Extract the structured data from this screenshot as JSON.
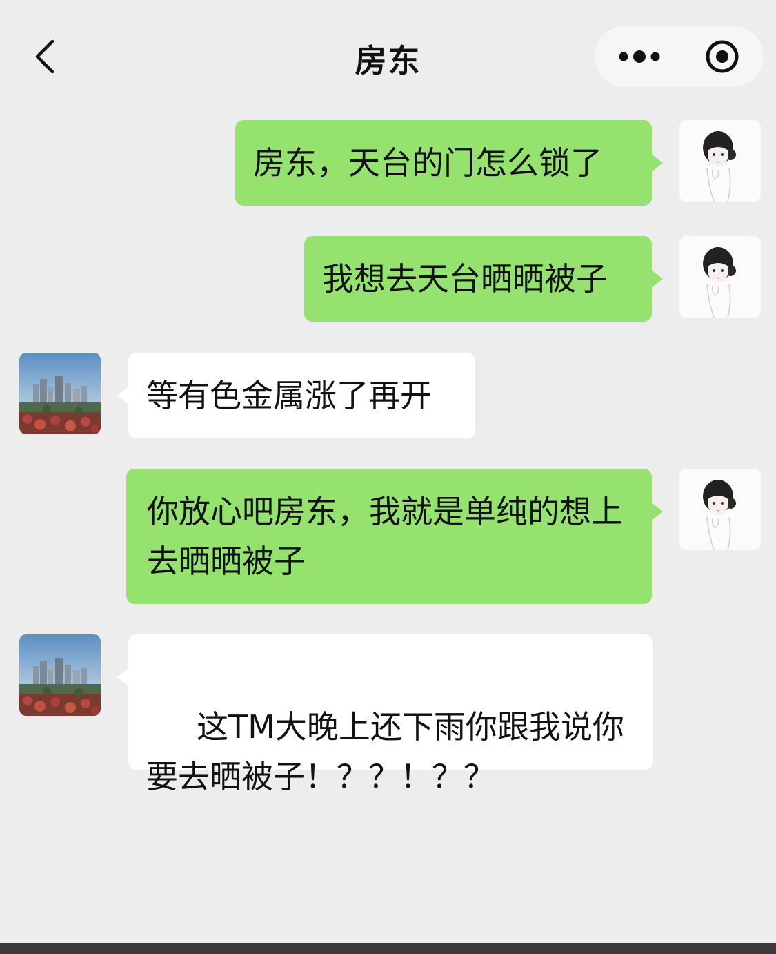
{
  "header": {
    "title": "房东",
    "back_icon": "chevron-left-icon",
    "more_icon": "more-dots-icon",
    "close_icon": "target-close-icon"
  },
  "colors": {
    "background": "#ededed",
    "sent_bubble": "#95e36e",
    "received_bubble": "#ffffff"
  },
  "messages": [
    {
      "side": "right",
      "text": "房东，天台的门怎么锁了"
    },
    {
      "side": "right",
      "text": "我想去天台晒晒被子"
    },
    {
      "side": "left",
      "text": "等有色金属涨了再开"
    },
    {
      "side": "right",
      "text": "你放心吧房东，我就是单纯的想上去晒晒被子"
    },
    {
      "side": "left",
      "text": " 这TM大晚上还下雨你跟我说你要去晒被子！？？！？？"
    }
  ]
}
